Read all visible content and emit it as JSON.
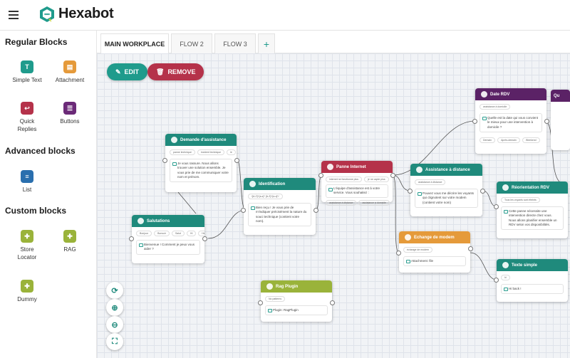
{
  "app": {
    "brand": "Hexabot"
  },
  "sidebar": {
    "sections": [
      {
        "title": "Regular Blocks"
      },
      {
        "title": "Advanced blocks"
      },
      {
        "title": "Custom blocks"
      }
    ],
    "blocks": [
      {
        "label": "Simple Text",
        "icon": "simple-text-icon",
        "color": "#1f9b8c"
      },
      {
        "label": "Attachment",
        "icon": "attachment-icon",
        "color": "#e59a3a"
      },
      {
        "label": "Quick Replies",
        "icon": "quick-replies-icon",
        "color": "#b5324a"
      },
      {
        "label": "Buttons",
        "icon": "buttons-icon",
        "color": "#6b2a78"
      },
      {
        "label": "List",
        "icon": "list-icon",
        "color": "#2a6fae"
      },
      {
        "label": "Store Locator",
        "icon": "puzzle-icon",
        "color": "#9ab33a"
      },
      {
        "label": "RAG",
        "icon": "puzzle-icon",
        "color": "#9ab33a"
      },
      {
        "label": "Dummy",
        "icon": "puzzle-icon",
        "color": "#9ab33a"
      }
    ]
  },
  "tabs": [
    {
      "label": "MAIN WORKPLACE",
      "active": true
    },
    {
      "label": "FLOW 2",
      "active": false
    },
    {
      "label": "FLOW 3",
      "active": false
    }
  ],
  "toolbar": {
    "edit_label": "EDIT",
    "remove_label": "REMOVE"
  },
  "nodes": {
    "demande": {
      "title": "Demande d'assistance",
      "chips": [
        "panne technique",
        "incident technique",
        "ie"
      ],
      "text": "Je vous rassure. Nous allons trouver une solution ensemble. Je vous prie de me communiquer votre nom et prénom."
    },
    "salutations": {
      "title": "Salutations",
      "chips": [
        "Bonjour",
        "Bonsoir",
        "Salut",
        "Hi",
        "Hello"
      ],
      "text": "Bienvenue ! Comment je peux vous aider ?"
    },
    "identification": {
      "title": "Identification",
      "chips": [
        "/[A-Z]+[a-z]* [A-Z]+[a-z]*/"
      ],
      "text": "Bien reçu ! Je vous prie de m'indiquer précisément la nature du souci technique (contient votre nom)."
    },
    "panne": {
      "title": "Panne Internet",
      "chips": [
        "internet ne fonctionne plus",
        "je ne capte plus"
      ],
      "text": "L'équipe d'assistance est à votre service. Vous souhaitez :",
      "buttons": [
        "assistance à distance",
        "assistance à domicile"
      ]
    },
    "assistance": {
      "title": "Assistance à distance",
      "chips": [
        "assistance à distance"
      ],
      "text": "Pouvez vous me décrire les voyants qui clignotent sur votre modem (contient votre nom)"
    },
    "rdv": {
      "title": "Date RDV",
      "chips": [
        "assistance à domicile"
      ],
      "text": "Quelle est la date qui vous convient le mieux pour une intervention à domicile ?",
      "buttons": [
        "Demain",
        "Après-demain",
        "Weekend"
      ]
    },
    "reorientation": {
      "title": "Réorientation RDV",
      "chips": [
        "Tous les voyants sont éteints"
      ],
      "text": "Cette panne nécessite une intervention directe chez vous. Nous allons planifier ensemble un RDV selon vos disponibilités."
    },
    "echange": {
      "title": "Echange de modem",
      "chips": [
        "échange de modem"
      ],
      "text": "Attachment: file"
    },
    "texte": {
      "title": "Texte simple",
      "chips": [
        "hi"
      ],
      "text": "Hi back !"
    },
    "rag": {
      "title": "Rag Plugin",
      "chips": [
        "No patterns"
      ],
      "text": "Plugin: RagPlugin"
    },
    "partial": {
      "title": "Qu"
    }
  }
}
